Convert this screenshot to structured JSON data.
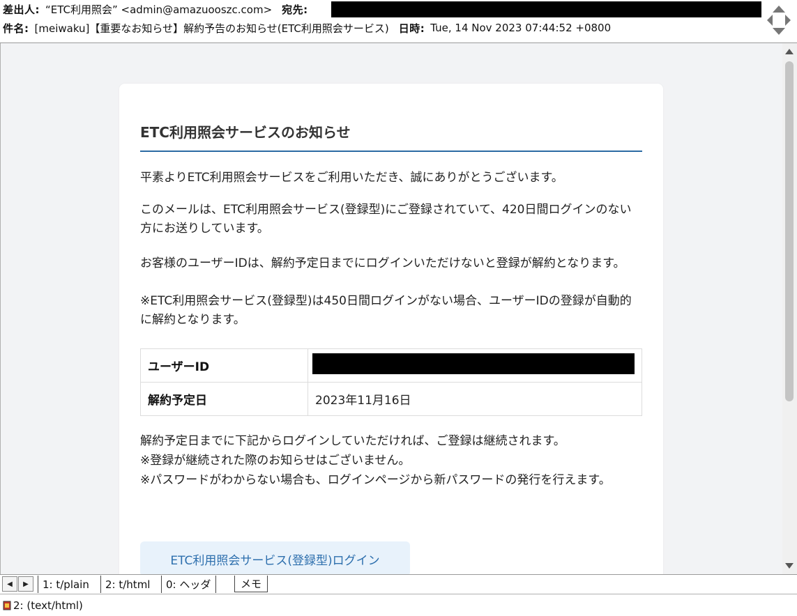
{
  "header": {
    "from_label": "差出人:",
    "from_value": "“ETC利用照会” <admin@amazuooszc.com>",
    "to_label": "宛先:",
    "subject_label": "件名:",
    "subject_value": "[meiwaku]【重要なお知らせ】解約予告のお知らせ(ETC利用照会サービス)",
    "date_label": "日時:",
    "date_value": "Tue, 14 Nov 2023 07:44:52 +0800"
  },
  "email": {
    "title": "ETC利用照会サービスのお知らせ",
    "paragraph1": "平素よりETC利用照会サービスをご利用いただき、誠にありがとうございます。",
    "paragraph2": "このメールは、ETC利用照会サービス(登録型)にご登録されていて、420日間ログインのない方にお送りしています。",
    "paragraph3": "お客様のユーザーIDは、解約予定日までにログインいただけないと登録が解約となります。",
    "paragraph3_note": "※ETC利用照会サービス(登録型)は450日間ログインがない場合、ユーザーIDの登録が自動的に解約となります。",
    "table": {
      "user_id_label": "ユーザーID",
      "cancel_date_label": "解約予定日",
      "cancel_date_value": "2023年11月16日"
    },
    "paragraph4": "解約予定日までに下記からログインしていただければ、ご登録は継続されます。",
    "paragraph4_note1": "※登録が継続された際のお知らせはございません。",
    "paragraph4_note2": "※パスワードがわからない場合も、ログインページから新パスワードの発行を行えます。",
    "login_button": "ETC利用照会サービス(登録型)ログイン"
  },
  "tabs": {
    "prev": "◀",
    "next": "▶",
    "items": [
      "1: t/plain",
      "2: t/html",
      "0: ヘッダ"
    ],
    "memo": "メモ"
  },
  "status": {
    "text": "2: (text/html)"
  }
}
